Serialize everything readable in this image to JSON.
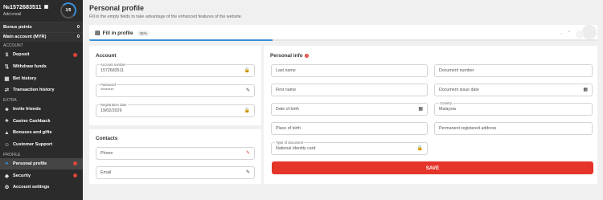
{
  "sidebar": {
    "user_id": "№1572683511",
    "add_email": "Add email",
    "level": "1/5",
    "bonus_points": {
      "label": "Bonus points",
      "value": "0"
    },
    "main_account": {
      "label": "Main account (MYR)",
      "value": "0"
    },
    "sections": {
      "account": "ACCOUNT",
      "extra": "EXTRA",
      "profile": "PROFILE"
    },
    "items": [
      {
        "label": "Deposit",
        "icon": "dollar-icon"
      },
      {
        "label": "Withdraw funds",
        "icon": "withdraw-icon"
      },
      {
        "label": "Bet history",
        "icon": "history-icon"
      },
      {
        "label": "Transaction history",
        "icon": "transactions-icon"
      },
      {
        "label": "Invite friends",
        "icon": "friends-icon"
      },
      {
        "label": "Casino Cashback",
        "icon": "cashback-icon"
      },
      {
        "label": "Bonuses and gifts",
        "icon": "gift-icon"
      },
      {
        "label": "Customer Support",
        "icon": "support-icon"
      },
      {
        "label": "Personal profile",
        "icon": "user-icon"
      },
      {
        "label": "Security",
        "icon": "shield-icon"
      },
      {
        "label": "Account settings",
        "icon": "settings-icon"
      }
    ],
    "accent": "#3a8fd6",
    "badge_color": "#e0433a"
  },
  "header": {
    "title": "Personal profile",
    "subtitle": "Fill in the empty fields to take advantage of the enhanced features of the website."
  },
  "progress": {
    "label": "Fill in profile",
    "percent_text": "36%",
    "fraction": 0.36
  },
  "account": {
    "title": "Account",
    "number": {
      "label": "Account number",
      "value": "1572683511"
    },
    "password": {
      "label": "Password",
      "value": "********"
    },
    "registration": {
      "label": "Registration date",
      "value": "19/02/2026"
    }
  },
  "contacts": {
    "title": "Contacts",
    "phone": "Phone",
    "email": "Email"
  },
  "personal_info": {
    "title": "Personal info",
    "last_name": "Last name",
    "document_number": "Document number",
    "first_name": "First name",
    "document_issue_date": "Document issue date",
    "date_of_birth": "Date of birth",
    "country": {
      "label": "Country",
      "value": "Malaysia"
    },
    "place_of_birth": "Place of birth",
    "permanent_address": "Permanent registered address",
    "type_of_document": {
      "label": "Type of document",
      "value": "National identity card"
    },
    "save": "SAVE",
    "save_color": "#e5352b"
  }
}
